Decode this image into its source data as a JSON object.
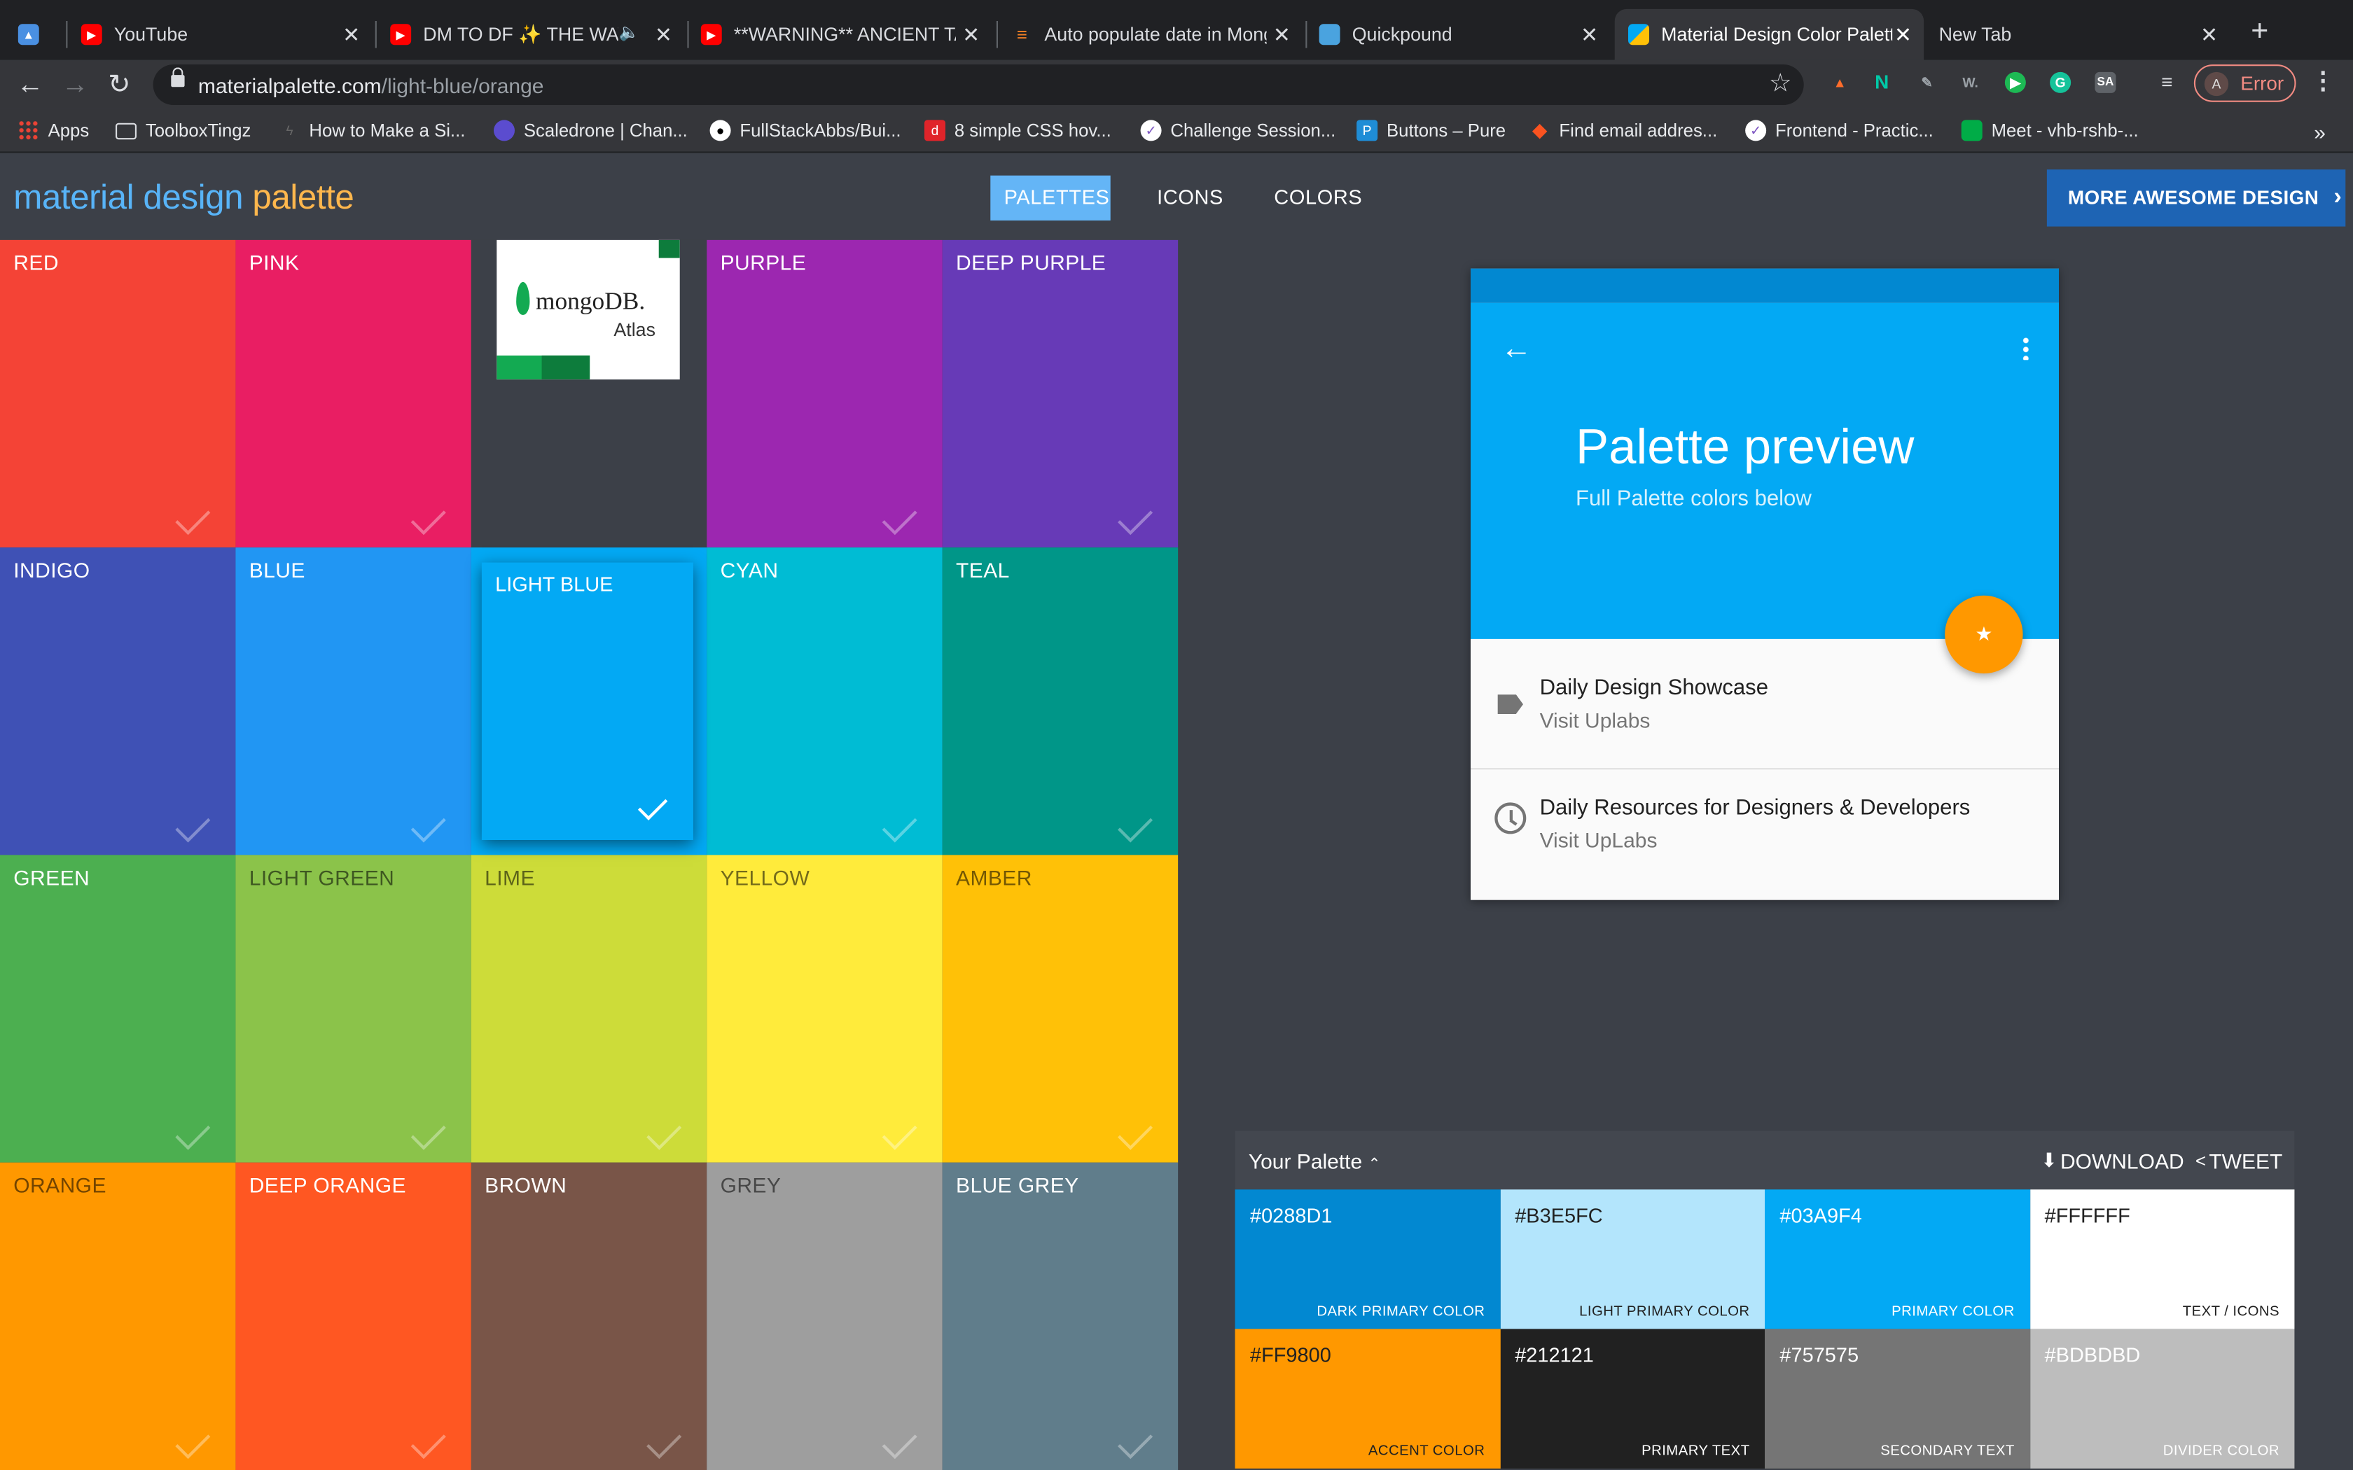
{
  "browser": {
    "tabs": [
      {
        "title": "",
        "icon": "browser-icon",
        "color": "#4a90e2"
      },
      {
        "title": "YouTube",
        "icon": "youtube-icon",
        "color": "#ff0000"
      },
      {
        "title": "DM TO DF ✨ THE WAY",
        "icon": "youtube-icon",
        "color": "#ff0000"
      },
      {
        "title": "**WARNING** ANCIENT TA",
        "icon": "youtube-icon",
        "color": "#ff0000"
      },
      {
        "title": "Auto populate date in Mong",
        "icon": "stackoverflow-icon",
        "color": "#f48024"
      },
      {
        "title": "Quickpound",
        "icon": "quickpound-icon",
        "color": "#4aa3df"
      },
      {
        "title": "Material Design Color Palett",
        "icon": "materialpalette-icon",
        "color": "#03a9f4"
      },
      {
        "title": "New Tab",
        "icon": "",
        "color": ""
      }
    ],
    "new_tab_label": "+",
    "url_host": "materialpalette.com",
    "url_path": "/light-blue/orange",
    "profile_initial": "A",
    "profile_status": "Error",
    "bookmarks": [
      {
        "label": "Apps",
        "icon": "apps-grid-icon",
        "color": "#ea4335"
      },
      {
        "label": "ToolboxTingz",
        "icon": "folder-icon",
        "color": "#9aa0a6"
      },
      {
        "label": "How to Make a Si...",
        "icon": "site-icon",
        "color": "#555"
      },
      {
        "label": "Scaledrone | Chan...",
        "icon": "scaledrone-icon",
        "color": "#5b4ccf"
      },
      {
        "label": "FullStackAbbs/Bui...",
        "icon": "github-icon",
        "color": "#ffffff"
      },
      {
        "label": "8 simple CSS hov...",
        "icon": "site-icon",
        "color": "#e0242a"
      },
      {
        "label": "Challenge Session...",
        "icon": "check-badge-icon",
        "color": "#7e57c2"
      },
      {
        "label": "Buttons – Pure",
        "icon": "pure-icon",
        "color": "#1f8dd6"
      },
      {
        "label": "Find email addres...",
        "icon": "hunter-icon",
        "color": "#fa5320"
      },
      {
        "label": "Frontend - Practic...",
        "icon": "check-badge-icon",
        "color": "#7e57c2"
      },
      {
        "label": "Meet - vhb-rshb-...",
        "icon": "meet-icon",
        "color": "#00ac47"
      }
    ],
    "bookmarks_overflow": "»"
  },
  "header": {
    "logo_main": "material design ",
    "logo_accent": "palette",
    "nav": [
      "PALETTES",
      "ICONS",
      "COLORS"
    ],
    "active_nav": "PALETTES",
    "cta": "MORE AWESOME DESIGN",
    "cta_arrow": "›"
  },
  "swatches": [
    {
      "name": "RED",
      "color": "#f44336"
    },
    {
      "name": "PINK",
      "color": "#e91e63"
    },
    {
      "name": "",
      "color": "#3c4048"
    },
    {
      "name": "PURPLE",
      "color": "#9c27b0"
    },
    {
      "name": "DEEP PURPLE",
      "color": "#673ab7"
    },
    {
      "name": "INDIGO",
      "color": "#3f51b5"
    },
    {
      "name": "BLUE",
      "color": "#2196f3"
    },
    {
      "name": "LIGHT BLUE",
      "color": "#03a9f4"
    },
    {
      "name": "CYAN",
      "color": "#00bcd4"
    },
    {
      "name": "TEAL",
      "color": "#009688"
    },
    {
      "name": "GREEN",
      "color": "#4caf50"
    },
    {
      "name": "LIGHT GREEN",
      "color": "#8bc34a"
    },
    {
      "name": "LIME",
      "color": "#cddc39"
    },
    {
      "name": "YELLOW",
      "color": "#ffeb3b"
    },
    {
      "name": "AMBER",
      "color": "#ffc107"
    },
    {
      "name": "ORANGE",
      "color": "#ff9800"
    },
    {
      "name": "DEEP ORANGE",
      "color": "#ff5722"
    },
    {
      "name": "BROWN",
      "color": "#795548"
    },
    {
      "name": "GREY",
      "color": "#9e9e9e"
    },
    {
      "name": "BLUE GREY",
      "color": "#607d8b"
    }
  ],
  "selected_swatch": "LIGHT BLUE",
  "ad": {
    "brand": "mongoDB.",
    "product": "Atlas"
  },
  "preview": {
    "title": "Palette preview",
    "subtitle": "Full Palette colors below",
    "fab_icon": "★",
    "items": [
      {
        "title": "Daily Design Showcase",
        "subtitle": "Visit Uplabs",
        "icon": "label-icon"
      },
      {
        "title": "Daily Resources for Designers & Developers",
        "subtitle": "Visit UpLabs",
        "icon": "clock-icon"
      }
    ]
  },
  "palette": {
    "title": "Your Palette",
    "download_label": "DOWNLOAD",
    "tweet_label": "TWEET",
    "colors": [
      {
        "hex": "#0288D1",
        "label": "DARK PRIMARY COLOR",
        "text_color": "#ffffff"
      },
      {
        "hex": "#B3E5FC",
        "label": "LIGHT PRIMARY COLOR",
        "text_color": "#212121"
      },
      {
        "hex": "#03A9F4",
        "label": "PRIMARY COLOR",
        "text_color": "#ffffff"
      },
      {
        "hex": "#FFFFFF",
        "label": "TEXT / ICONS",
        "text_color": "#212121"
      },
      {
        "hex": "#FF9800",
        "label": "ACCENT COLOR",
        "text_color": "#212121"
      },
      {
        "hex": "#212121",
        "label": "PRIMARY TEXT",
        "text_color": "#ffffff"
      },
      {
        "hex": "#757575",
        "label": "SECONDARY TEXT",
        "text_color": "#ffffff"
      },
      {
        "hex": "#BDBDBD",
        "label": "DIVIDER COLOR",
        "text_color": "#ffffff"
      }
    ]
  }
}
